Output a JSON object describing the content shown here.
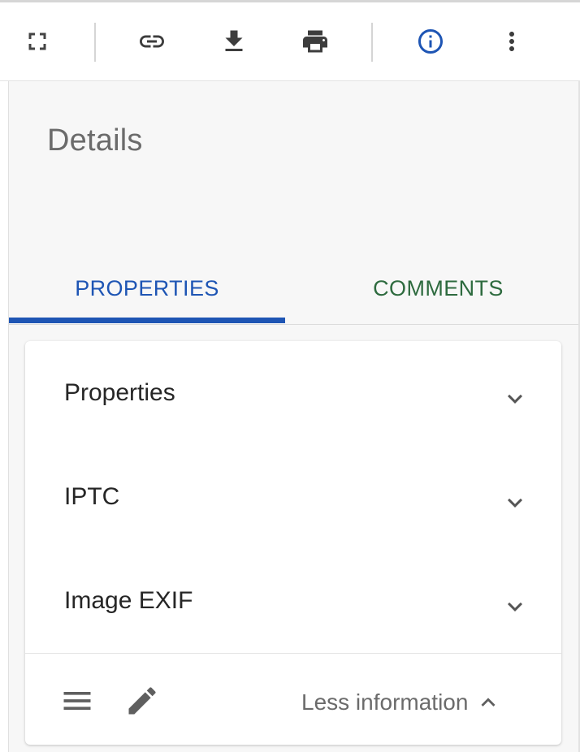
{
  "toolbar": {
    "buttons": [
      {
        "name": "fullscreen",
        "icon": "fullscreen-icon"
      },
      {
        "name": "share-link",
        "icon": "link-icon"
      },
      {
        "name": "download",
        "icon": "download-icon"
      },
      {
        "name": "print",
        "icon": "print-icon"
      },
      {
        "name": "info",
        "icon": "info-icon",
        "active_color": "#1e55b4"
      },
      {
        "name": "more",
        "icon": "more-vertical-icon"
      }
    ]
  },
  "panel": {
    "title": "Details",
    "tabs": [
      {
        "label": "PROPERTIES",
        "active": true,
        "color": "#1e55b4"
      },
      {
        "label": "COMMENTS",
        "active": false,
        "color": "#2e6b3f"
      }
    ],
    "sections": [
      {
        "label": "Properties",
        "icon": "chevron-down-icon"
      },
      {
        "label": "IPTC",
        "icon": "chevron-down-icon"
      },
      {
        "label": "Image EXIF",
        "icon": "chevron-down-icon"
      }
    ],
    "footer": {
      "menu_icon": "menu-icon",
      "edit_icon": "edit-icon",
      "toggle_label": "Less information",
      "toggle_icon": "chevron-up-icon"
    }
  }
}
